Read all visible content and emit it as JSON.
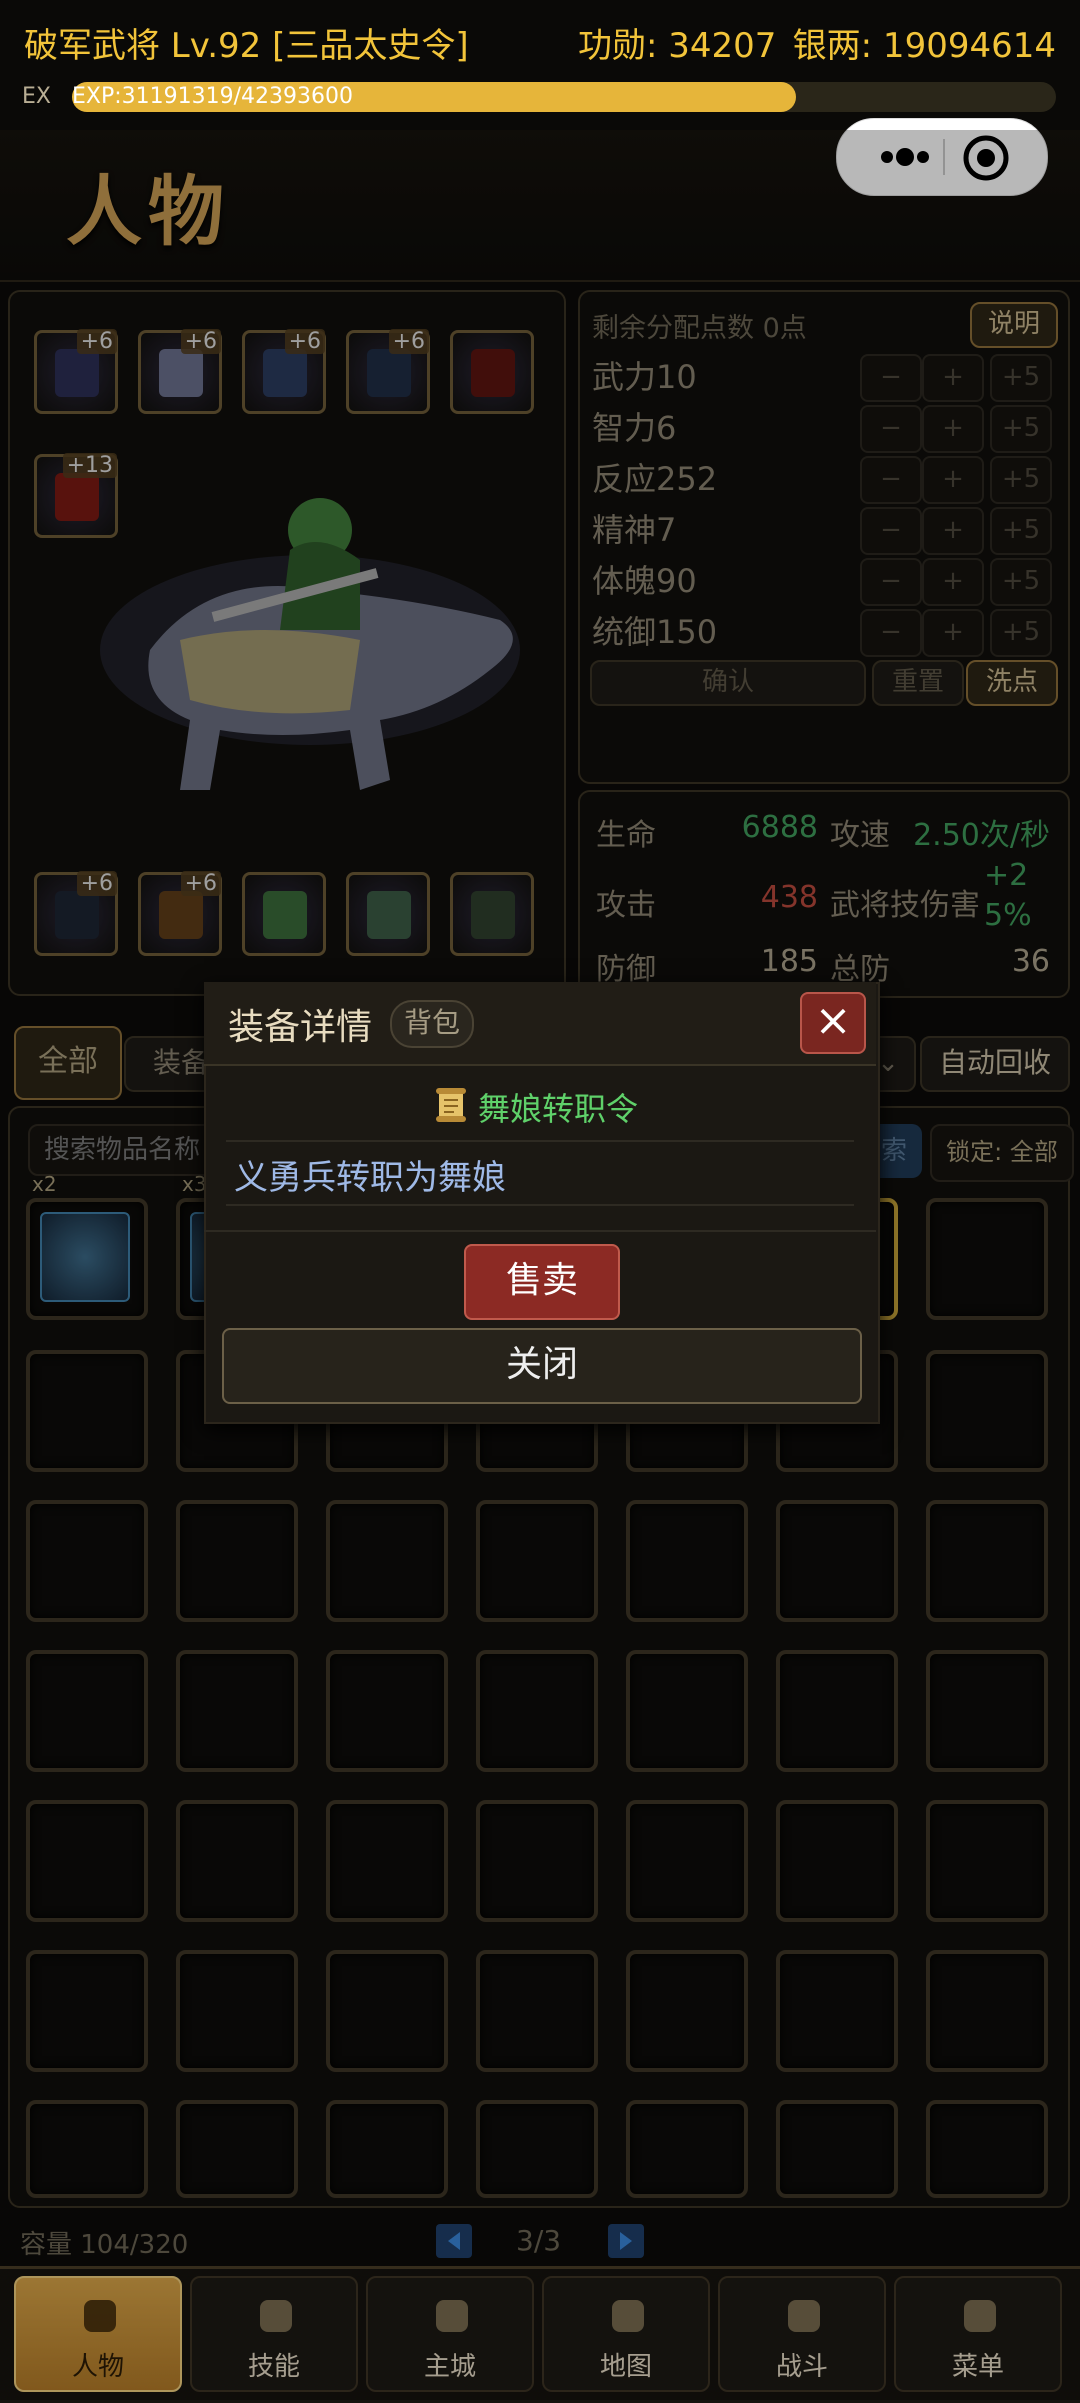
{
  "header": {
    "name": "破军武将 Lv.92 [三品太史令]",
    "merit": "功勋: 34207",
    "silver": "银两: 19094614",
    "ex_label": "EX",
    "exp_text": "EXP:31191319/42393600",
    "exp_progress": 0.7357
  },
  "page": {
    "title": "人物"
  },
  "equipment": {
    "top_slots": [
      {
        "icon": "armor-icon",
        "plus": "+6",
        "color": "#2c2f55"
      },
      {
        "icon": "chest-armor-icon",
        "plus": "+6",
        "color": "#6a6f8c"
      },
      {
        "icon": "boots-icon",
        "plus": "+6",
        "color": "#2a3b5e"
      },
      {
        "icon": "bracer-icon",
        "plus": "+6",
        "color": "#1f2d45"
      },
      {
        "icon": "red-gem-icon",
        "plus": "",
        "color": "#5a1410"
      }
    ],
    "weapon_slot": {
      "icon": "sword-icon",
      "plus": "+13",
      "color": "#7a1a12"
    },
    "bottom_slots": [
      {
        "icon": "armor-icon",
        "plus": "+6",
        "color": "#1c2433"
      },
      {
        "icon": "scroll-icon",
        "plus": "+6",
        "color": "#5e3c18"
      },
      {
        "icon": "mount-icon",
        "plus": "",
        "color": "#3a6a3a"
      },
      {
        "icon": "medal-icon",
        "plus": "",
        "color": "#3b5a45"
      },
      {
        "icon": "seal-icon",
        "plus": "",
        "color": "#2f3f2d"
      }
    ]
  },
  "allocation": {
    "remaining": "剩余分配点数 0点",
    "help": "说明",
    "stats": [
      {
        "label": "武力10",
        "minus": "−",
        "plus": "+",
        "plus5": "+5"
      },
      {
        "label": "智力6",
        "minus": "−",
        "plus": "+",
        "plus5": "+5"
      },
      {
        "label": "反应252",
        "minus": "−",
        "plus": "+",
        "plus5": "+5"
      },
      {
        "label": "精神7",
        "minus": "−",
        "plus": "+",
        "plus5": "+5"
      },
      {
        "label": "体魄90",
        "minus": "−",
        "plus": "+",
        "plus5": "+5"
      },
      {
        "label": "统御150",
        "minus": "−",
        "plus": "+",
        "plus5": "+5"
      }
    ],
    "confirm": "确认",
    "reset": "重置",
    "wash": "洗点"
  },
  "attributes": {
    "hp_label": "生命",
    "hp_value": "6888",
    "aspd_label": "攻速",
    "aspd_value": "2.50次/秒",
    "atk_label": "攻击",
    "atk_value": "438",
    "skill_dmg_label": "武将技伤害",
    "skill_dmg_line1": "+2",
    "skill_dmg_line2": "5%",
    "def_label": "防御",
    "def_value": "185",
    "total_def_label": "总防",
    "total_def_value": "36"
  },
  "inventory": {
    "filter_all": "全部",
    "filter_equip": "装备",
    "auto_recycle": "自动回收",
    "search_placeholder": "搜索物品名称",
    "search_button": "索",
    "lock_label": "锁定: 全部",
    "first_items": [
      {
        "icon": "card-icon",
        "count": "x2"
      },
      {
        "icon": "card-icon",
        "count": "x3"
      }
    ],
    "capacity": "容量 104/320",
    "page": "3/3"
  },
  "modal": {
    "title": "装备详情",
    "tag": "背包",
    "close_icon": "×",
    "item_name": "舞娘转职令",
    "item_icon": "scroll-icon",
    "description": "义勇兵转职为舞娘",
    "sell": "售卖",
    "close": "关闭"
  },
  "nav": [
    {
      "label": "人物",
      "icon": "character-icon",
      "active": true
    },
    {
      "label": "技能",
      "icon": "skill-scroll-icon",
      "active": false
    },
    {
      "label": "主城",
      "icon": "castle-icon",
      "active": false
    },
    {
      "label": "地图",
      "icon": "map-icon",
      "active": false
    },
    {
      "label": "战斗",
      "icon": "crossed-swords-icon",
      "active": false
    },
    {
      "label": "菜单",
      "icon": "menu-scroll-icon",
      "active": false
    }
  ],
  "colors": {
    "gold": "#f2c43a",
    "hp_green": "#3f9a5a",
    "atk_red": "#b7483c",
    "item_green": "#5fd16a",
    "sell_red": "#8c2a24"
  }
}
